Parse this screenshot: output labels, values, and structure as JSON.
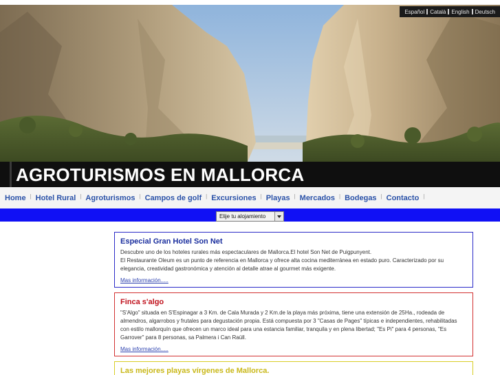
{
  "languages": [
    "Español",
    "Català",
    "English",
    "Deutsch"
  ],
  "site_title": "AGROTURISMOS EN MALLORCA",
  "nav": [
    "Home",
    "Hotel Rural",
    "Agroturismos",
    "Campos de golf",
    "Excursiones",
    "Playas",
    "Mercados",
    "Bodegas",
    "Contacto"
  ],
  "selector": {
    "label": "Elije tu alojamiento"
  },
  "cards": [
    {
      "title": "Especial Gran Hotel Son Net",
      "lines": [
        "Descubre uno de los hoteles rurales más espectaculares de Mallorca.El hotel Son Net de Puigpunyent.",
        "El Restaurante Oleum es un punto de referencia en Mallorca y ofrece alta cocina mediterránea en estado puro. Caracterizado por su elegancia, creatividad gastronómica y atención al detalle atrae al gourmet más exigente."
      ],
      "link": "Mas información....."
    },
    {
      "title": "Finca s'algo",
      "lines": [
        "\"S'Algo\" situada en S'Espinagar a 3 Km. de Cala Murada y 2 Km.de la playa más próxima, tiene una extensión de 25Ha., rodeada de almendros, algarrobos y frutales para degustación propia. Está compuesta por 3 \"Casas de Pages\" típicas e independientes, rehabilitadas con estilo mallorquín que ofrecen un marco ideal para una estancia familiar, tranquila y en plena libertad; \"Es Pi\" para 4 personas, \"Es Garrover\" para 8 personas, sa Palmera i Can Raüll."
      ],
      "link": "Mas información....."
    },
    {
      "title": "Las mejores playas vírgenes de Mallorca."
    }
  ],
  "colors": {
    "nav_link": "#2b52a8",
    "blue_bar": "#1010f5",
    "card_1_border": "#2a2ac8",
    "card_2_border": "#d23030",
    "card_3_border": "#d8cd25"
  }
}
